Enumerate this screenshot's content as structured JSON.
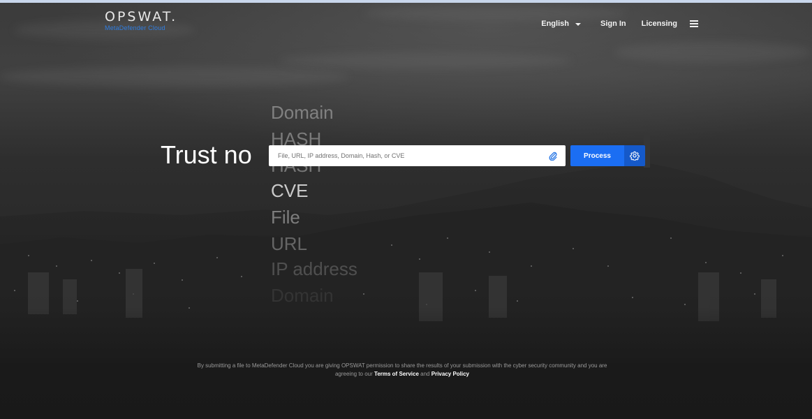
{
  "header": {
    "logo_wordmark": "OPSWAT.",
    "logo_product": "MetaDefender Cloud",
    "nav": {
      "language": "English",
      "sign_in": "Sign In",
      "licensing": "Licensing"
    }
  },
  "hero": {
    "title": "Trust no",
    "rotating_words": [
      {
        "text": "Domain",
        "opacity": 0.35
      },
      {
        "text": "HASH",
        "opacity": 0.35
      },
      {
        "text": "HASH",
        "opacity": 0.35
      },
      {
        "text": "CVE",
        "opacity": 0.75
      },
      {
        "text": "File",
        "opacity": 0.4
      },
      {
        "text": "URL",
        "opacity": 0.3
      },
      {
        "text": "IP address",
        "opacity": 0.2
      },
      {
        "text": "Domain",
        "opacity": 0.08
      }
    ],
    "search": {
      "placeholder": "File, URL, IP address, Domain, Hash, or CVE"
    },
    "process_label": "Process"
  },
  "footer": {
    "consent_line1": "By submitting a file to MetaDefender Cloud you are giving OPSWAT permission to share the results of your submission with the cyber security community and you are",
    "consent_prefix": "agreeing to our",
    "terms_label": "Terms of Service",
    "consent_and": "and",
    "privacy_label": "Privacy Policy"
  },
  "colors": {
    "accent": "#1b6ef3",
    "accent_dark": "#1559c9",
    "product_blue": "#2f7de1",
    "background": "#1a1a1a"
  },
  "icons": {
    "attach": "paperclip-icon",
    "settings": "gear-icon",
    "menu": "hamburger-menu-icon",
    "language_dropdown": "caret-down-icon"
  }
}
